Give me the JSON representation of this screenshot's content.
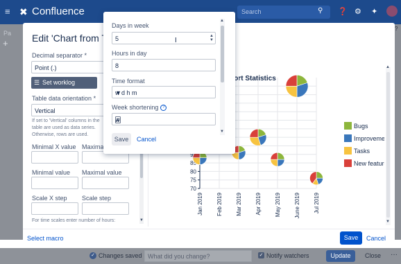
{
  "topbar": {
    "logo_text": "Confluence",
    "search_placeholder": "Search"
  },
  "page": {
    "crumb": "Pa"
  },
  "modal": {
    "title": "Edit 'Chart from Ta",
    "left": {
      "decimal_separator_label": "Decimal separator *",
      "decimal_separator_value": "Point (.)",
      "worklog_button": "Set worklog settings",
      "orientation_label": "Table data orientation *",
      "orientation_value": "Vertical",
      "orientation_help": "If set to 'Vertical' columns in the table are used as data series. Otherwise, rows are used.",
      "min_x_label": "Minimal X value",
      "max_x_label": "Maxima",
      "min_value_label": "Minimal value",
      "max_value_label": "Maximal value",
      "scale_x_label": "Scale X step",
      "scale_label": "Scale step",
      "scale_help": "For time scales enter number of hours:"
    },
    "footer": {
      "select_macro": "Select macro",
      "save": "Save",
      "cancel": "Cancel"
    }
  },
  "popup": {
    "days_label": "Days in week",
    "days_value": "5",
    "hours_label": "Hours in day",
    "hours_value": "8",
    "time_format_label": "Time format",
    "time_format_value": "w d h m",
    "week_short_label": "Week shortening",
    "week_short_value": "w",
    "save": "Save",
    "cancel": "Cancel"
  },
  "bottom_bar": {
    "changes_saved": "Changes saved",
    "change_placeholder": "What did you change?",
    "notify": "Notify watchers",
    "update": "Update",
    "close": "Close",
    "more": "···"
  },
  "colors": {
    "bugs": "#8db63c",
    "improvements": "#3a77bb",
    "tasks": "#f7c340",
    "new_features": "#d9403a",
    "topbar": "#1d4a8c",
    "primary": "#0052cc"
  },
  "chart_data": {
    "type": "scatter",
    "title": "pport Statistics",
    "categories": [
      "Jan 2019",
      "Feb 2019",
      "Mar 2019",
      "Apr 2019",
      "May 2019",
      "June 2019",
      "Jul 2019"
    ],
    "y_ticks": [
      70,
      75,
      80,
      85,
      90,
      95
    ],
    "legend": [
      "Bugs",
      "Improvements",
      "Tasks",
      "New features"
    ],
    "legend_position": "right",
    "points": [
      {
        "category": "Jan 2019",
        "y": 88,
        "size": 2,
        "shares": [
          0.25,
          0.25,
          0.25,
          0.25
        ]
      },
      {
        "category": "Mar 2019",
        "y": 91,
        "size": 2,
        "shares": [
          0.2,
          0.3,
          0.25,
          0.25
        ]
      },
      {
        "category": "Apr 2019",
        "y": 100,
        "size": 2.4,
        "shares": [
          0.2,
          0.25,
          0.3,
          0.25
        ]
      },
      {
        "category": "May 2019",
        "y": 87,
        "size": 2,
        "shares": [
          0.25,
          0.25,
          0.25,
          0.25
        ]
      },
      {
        "category": "June 2019",
        "y": 130,
        "size": 3.2,
        "shares": [
          0.2,
          0.3,
          0.25,
          0.25
        ]
      },
      {
        "category": "Jul 2019",
        "y": 76,
        "size": 1.9,
        "shares": [
          0.25,
          0.2,
          0.15,
          0.4
        ]
      }
    ]
  }
}
